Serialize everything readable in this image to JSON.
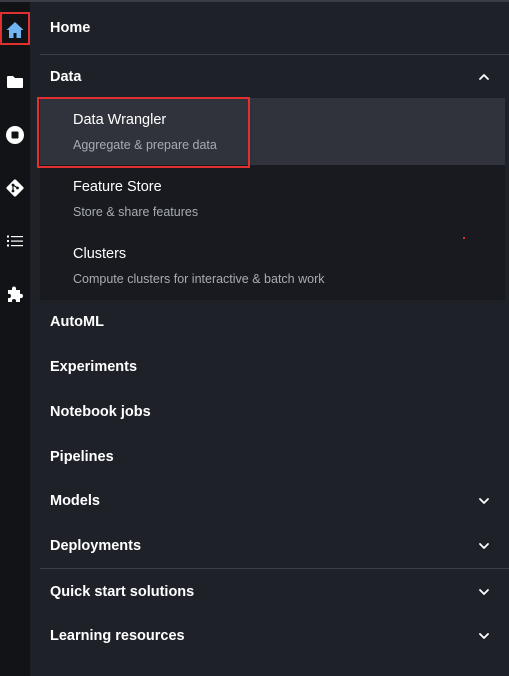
{
  "rail": {
    "icons": [
      "home-icon",
      "folder-icon",
      "stop-circle-icon",
      "git-icon",
      "list-icon",
      "puzzle-icon"
    ],
    "active_color": "#6fb6f2",
    "icon_color": "#ffffff"
  },
  "nav": {
    "home": "Home",
    "data": "Data",
    "data_subitems": [
      {
        "title": "Data Wrangler",
        "description": "Aggregate & prepare data"
      },
      {
        "title": "Feature Store",
        "description": "Store & share features"
      },
      {
        "title": "Clusters",
        "description": "Compute clusters for interactive & batch work"
      }
    ],
    "automl": "AutoML",
    "experiments": "Experiments",
    "notebook_jobs": "Notebook jobs",
    "pipelines": "Pipelines",
    "models": "Models",
    "deployments": "Deployments",
    "quick_start": "Quick start solutions",
    "learning": "Learning resources"
  },
  "colors": {
    "highlight": "#e0302f",
    "background": "#1e2128",
    "rail_background": "#111316"
  }
}
